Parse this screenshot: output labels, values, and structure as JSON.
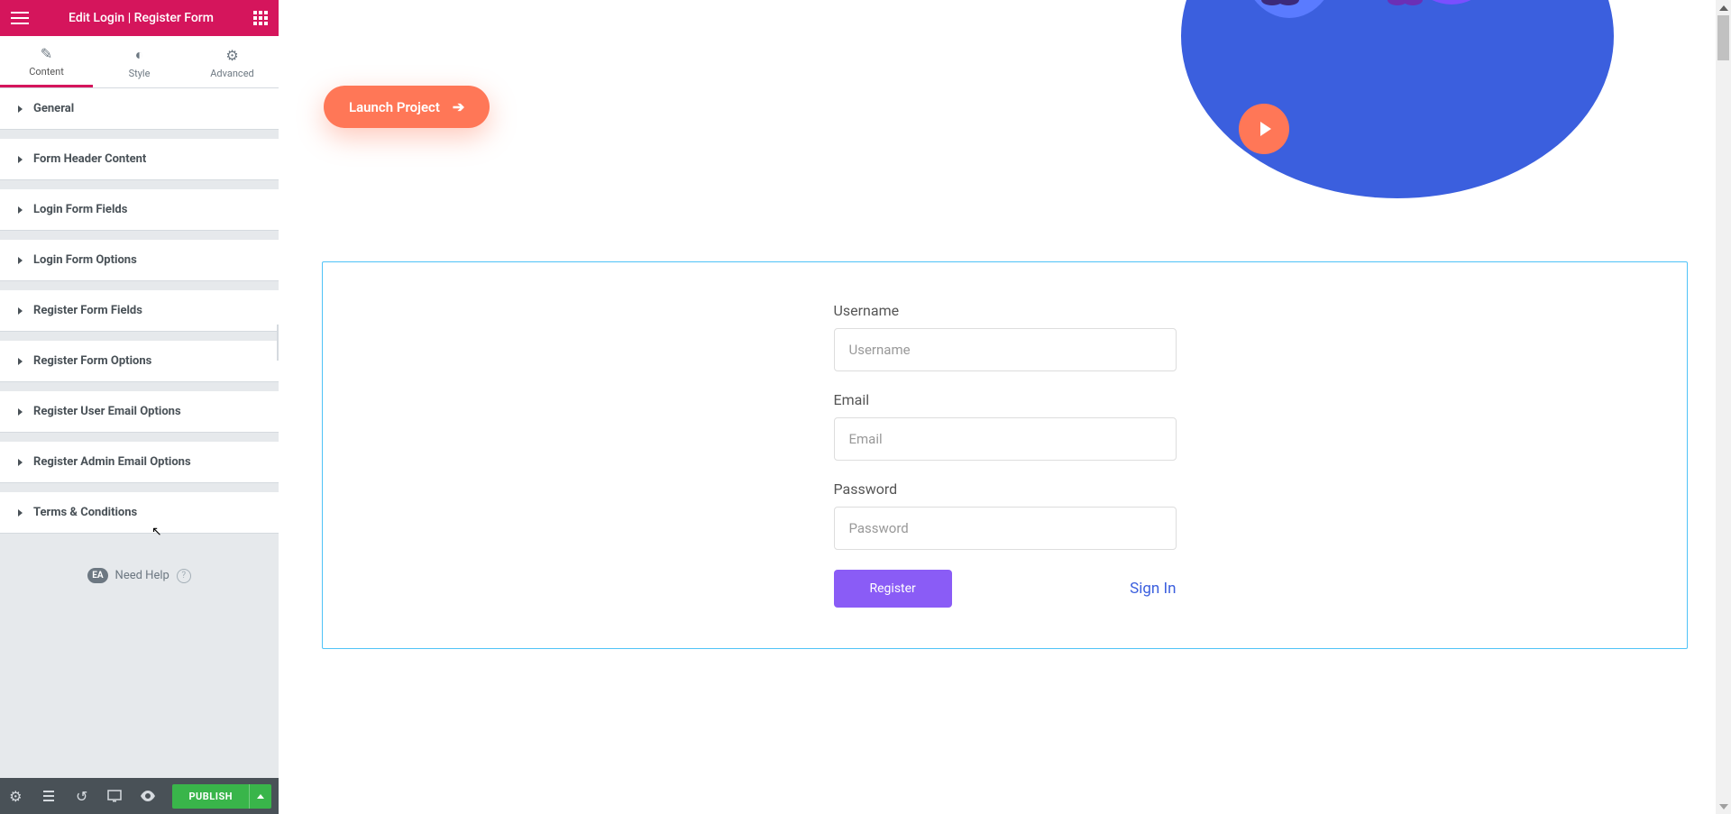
{
  "header": {
    "title": "Edit Login | Register Form"
  },
  "tabs": [
    {
      "label": "Content",
      "active": true
    },
    {
      "label": "Style",
      "active": false
    },
    {
      "label": "Advanced",
      "active": false
    }
  ],
  "sections": [
    {
      "label": "General"
    },
    {
      "label": "Form Header Content"
    },
    {
      "label": "Login Form Fields"
    },
    {
      "label": "Login Form Options"
    },
    {
      "label": "Register Form Fields"
    },
    {
      "label": "Register Form Options"
    },
    {
      "label": "Register User Email Options"
    },
    {
      "label": "Register Admin Email Options"
    },
    {
      "label": "Terms & Conditions"
    }
  ],
  "help": {
    "badge": "EA",
    "label": "Need Help"
  },
  "footer": {
    "publish": "PUBLISH"
  },
  "canvas": {
    "hero_button": "Launch Project",
    "form": {
      "username_label": "Username",
      "username_placeholder": "Username",
      "email_label": "Email",
      "email_placeholder": "Email",
      "password_label": "Password",
      "password_placeholder": "Password",
      "register_button": "Register",
      "signin_link": "Sign In"
    }
  },
  "colors": {
    "brand": "#d5155c",
    "accent": "#ff7757",
    "primary_btn": "#8a5cf6",
    "publish": "#39b54a",
    "selection_border": "#4fc3f7"
  }
}
